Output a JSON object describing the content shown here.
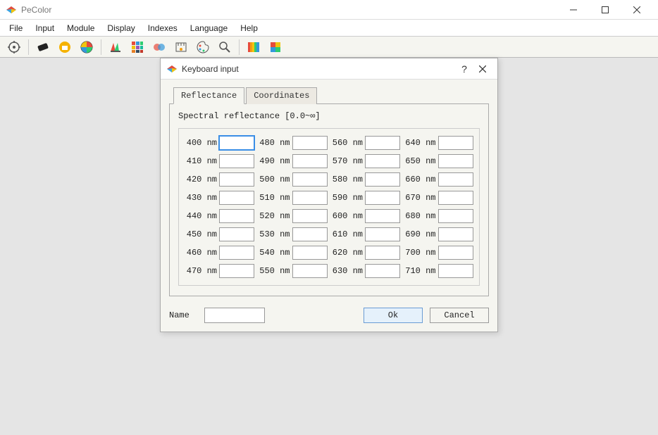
{
  "window": {
    "title": "PeColor"
  },
  "menu": {
    "items": [
      "File",
      "Input",
      "Module",
      "Display",
      "Indexes",
      "Language",
      "Help"
    ]
  },
  "toolbar": {
    "icons": [
      "settings",
      "swatch",
      "folder",
      "color-wheel",
      "palette",
      "color-grid",
      "layers",
      "ruler",
      "paint-palette",
      "magnifier",
      "spectrum",
      "hue-grid"
    ]
  },
  "dialog": {
    "title": "Keyboard input",
    "tabs": {
      "reflectance": "Reflectance",
      "coordinates": "Coordinates",
      "active": 0
    },
    "caption": "Spectral reflectance [0.0~∞]",
    "wavelengths": {
      "col1": [
        "400 nm",
        "410 nm",
        "420 nm",
        "430 nm",
        "440 nm",
        "450 nm",
        "460 nm",
        "470 nm"
      ],
      "col2": [
        "480 nm",
        "490 nm",
        "500 nm",
        "510 nm",
        "520 nm",
        "530 nm",
        "540 nm",
        "550 nm"
      ],
      "col3": [
        "560 nm",
        "570 nm",
        "580 nm",
        "590 nm",
        "600 nm",
        "610 nm",
        "620 nm",
        "630 nm"
      ],
      "col4": [
        "640 nm",
        "650 nm",
        "660 nm",
        "670 nm",
        "680 nm",
        "690 nm",
        "700 nm",
        "710 nm"
      ]
    },
    "name_label": "Name",
    "name_value": "",
    "ok": "Ok",
    "cancel": "Cancel"
  }
}
